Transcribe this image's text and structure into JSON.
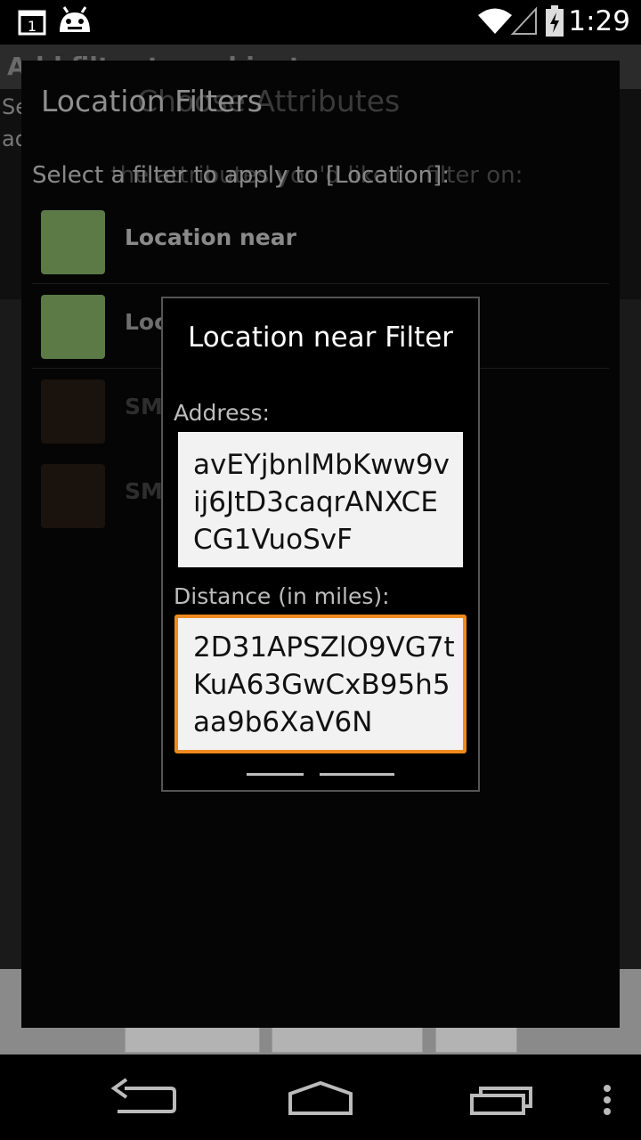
{
  "status_bar": {
    "time": "1:29",
    "calendar_day": "1",
    "icons": [
      "calendar-icon",
      "android-icon",
      "wifi-icon",
      "signal-icon",
      "battery-charging-icon"
    ]
  },
  "background_app": {
    "title": "Add filter to ambient ...",
    "subtext_lines": [
      "Se",
      "ad"
    ]
  },
  "filter_list_dialog": {
    "title": "Location Filters",
    "ghost_title": "Choose Attributes",
    "prompt": "Select a filter to apply to [Location]:",
    "ghost_prompt": "Select the attributes you'd like to filter on:",
    "items": [
      {
        "label": "Location near",
        "enabled": true
      },
      {
        "label": "Location query",
        "enabled": true
      },
      {
        "label": "SMS",
        "enabled": false
      },
      {
        "label": "SMS",
        "enabled": false
      }
    ]
  },
  "edit_dialog": {
    "title": "Location near Filter",
    "address_label": "Address:",
    "address_value": "avEYjbnlMbKww9vij6JtD3caqrANXCECG1VuoSvF",
    "distance_label": "Distance (in miles):",
    "distance_value": "2D31APSZlO9VG7tKuA63GwCxB95h5aa9b6XaV6N"
  },
  "nav_bar": {
    "buttons": [
      "back-button",
      "home-button",
      "recent-apps-button",
      "menu-button"
    ]
  },
  "colors": {
    "focus_accent": "#f08a1c",
    "enabled_icon": "#5b7a45",
    "disabled_icon": "#1a120c"
  }
}
